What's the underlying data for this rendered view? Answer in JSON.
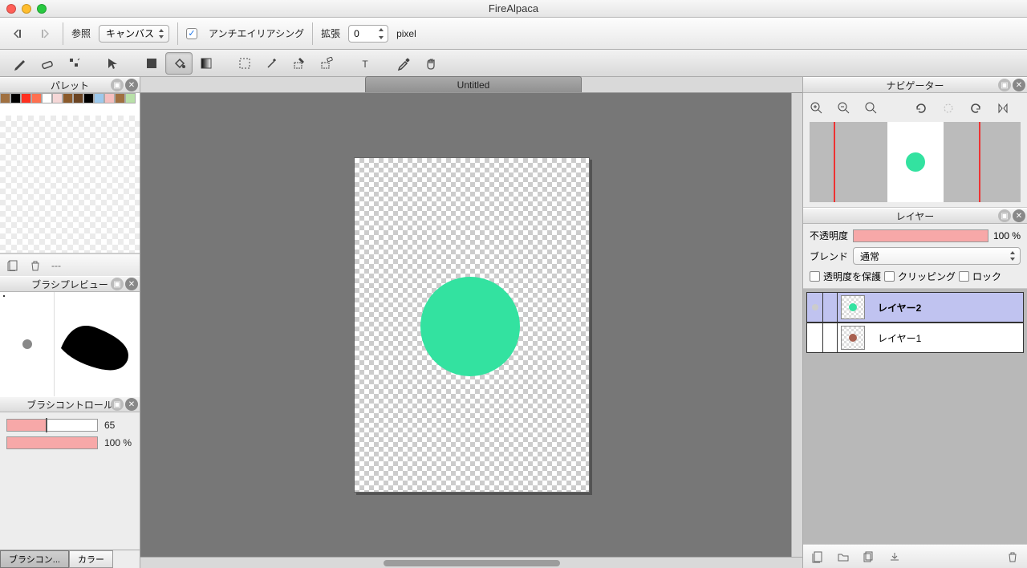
{
  "app": {
    "title": "FireAlpaca"
  },
  "options": {
    "reference_label": "参照",
    "reference_value": "キャンバス",
    "antialias_label": "アンチエイリアシング",
    "antialias_checked": "✓",
    "expand_label": "拡張",
    "expand_value": "0",
    "expand_unit": "pixel"
  },
  "document": {
    "tab_title": "Untitled"
  },
  "panels": {
    "palette_title": "パレット",
    "brush_preview_title": "ブラシプレビュー",
    "brush_control_title": "ブラシコントロール",
    "navigator_title": "ナビゲーター",
    "layers_title": "レイヤー"
  },
  "palette": {
    "footer_dash": "---",
    "swatches": [
      "#a07040",
      "#000000",
      "#ff3020",
      "#ff7050",
      "#ffffff",
      "#f5d7d7",
      "#8b5a2b",
      "#6b4423",
      "#000000",
      "#9cc8ec",
      "#f5bfbf",
      "#a07040",
      "#b8e0a8"
    ]
  },
  "brush_control": {
    "size_value": "65",
    "opacity_value": "100 %"
  },
  "left_tabs": {
    "active": "ブラシコン...",
    "inactive": "カラー"
  },
  "layer_opts": {
    "opacity_label": "不透明度",
    "opacity_value": "100 %",
    "blend_label": "ブレンド",
    "blend_value": "通常",
    "protect_alpha": "透明度を保護",
    "clipping": "クリッピング",
    "lock": "ロック"
  },
  "layers": [
    {
      "name": "レイヤー2",
      "color": "#33e2a0",
      "selected": true
    },
    {
      "name": "レイヤー1",
      "color": "#a86050",
      "selected": false
    }
  ],
  "colors": {
    "accent": "#33e2a0"
  }
}
